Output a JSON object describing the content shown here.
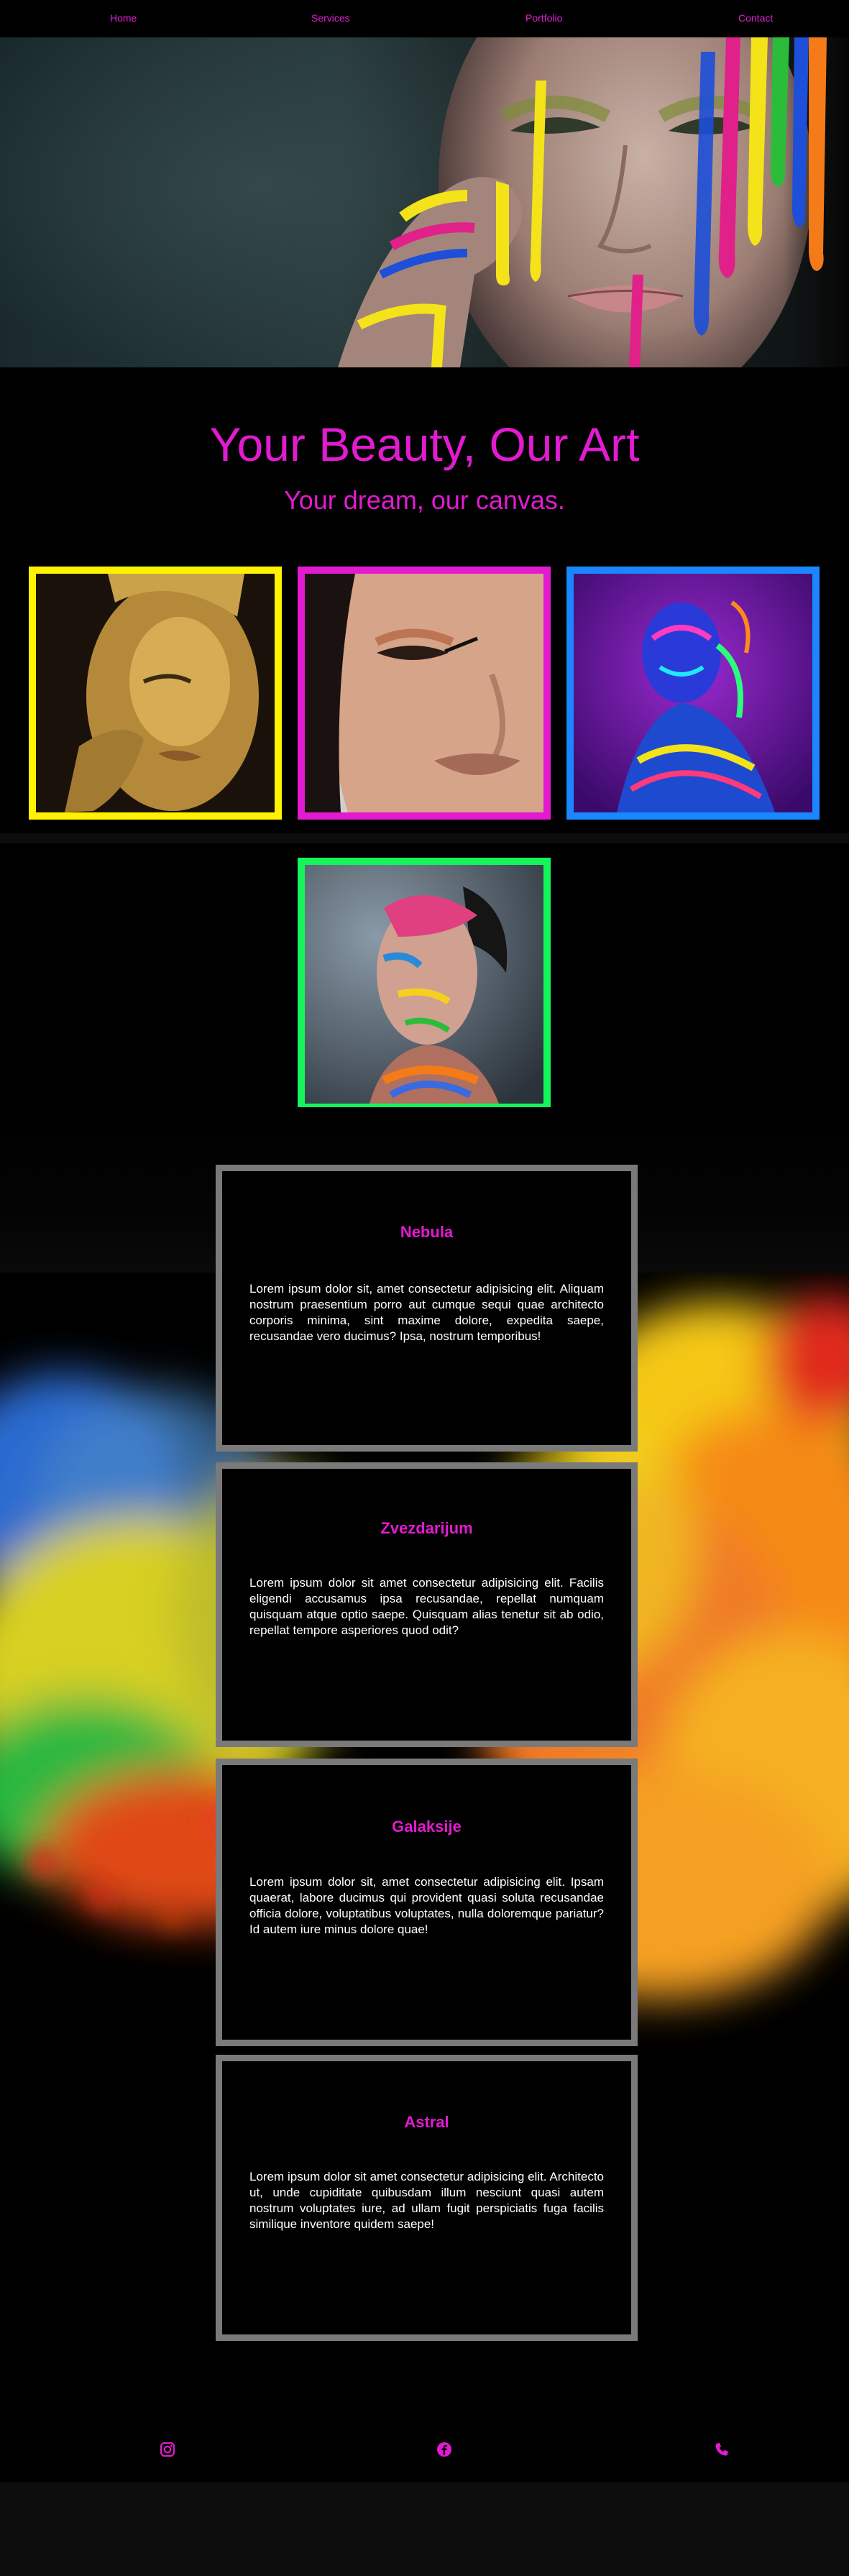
{
  "nav": {
    "items": [
      {
        "label": "Home"
      },
      {
        "label": "Services"
      },
      {
        "label": "Portfolio"
      },
      {
        "label": "Contact"
      }
    ]
  },
  "hero": {
    "image": "face-with-paint-drips",
    "colors": [
      "#f5e31a",
      "#e0218a",
      "#1d4fd8",
      "#2bbd3a",
      "#f57a18"
    ]
  },
  "headline": {
    "title": "Your Beauty, Our Art",
    "subtitle": "Your dream, our canvas."
  },
  "gallery": {
    "items": [
      {
        "image": "gold-makeup-portrait",
        "border_color": "#fff200"
      },
      {
        "image": "glam-eyeliner-portrait",
        "border_color": "#e21bd0"
      },
      {
        "image": "neon-uv-body-paint",
        "border_color": "#1a86ff"
      },
      {
        "image": "multicolor-face-paint",
        "border_color": "#14f55a"
      }
    ]
  },
  "cards": [
    {
      "title": "Nebula",
      "text": "Lorem ipsum dolor sit, amet consectetur adipisicing elit. Aliquam nostrum praesentium porro aut cumque sequi quae architecto corporis minima, sint maxime dolore, expedita saepe, recusandae vero ducimus? Ipsa, nostrum temporibus!"
    },
    {
      "title": "Zvezdarijum",
      "text": "Lorem ipsum dolor sit amet consectetur adipisicing elit. Facilis eligendi accusamus ipsa recusandae, repellat numquam quisquam atque optio saepe. Quisquam alias tenetur sit ab odio, repellat tempore asperiores quod odit?"
    },
    {
      "title": "Galaksije",
      "text": "Lorem ipsum dolor sit, amet consectetur adipisicing elit. Ipsam quaerat, labore ducimus qui provident quasi soluta recusandae officia dolore, voluptatibus voluptates, nulla doloremque pariatur? Id autem iure minus dolore quae!"
    },
    {
      "title": "Astral",
      "text": "Lorem ipsum dolor sit amet consectetur adipisicing elit. Architecto ut, unde cupiditate quibusdam illum nesciunt quasi autem nostrum voluptates iure, ad ullam fugit perspiciatis fuga facilis similique inventore quidem saepe!"
    }
  ],
  "footer": {
    "icons": [
      "instagram-icon",
      "facebook-icon",
      "phone-icon"
    ],
    "icon_color": "#e21bd0"
  },
  "colors": {
    "accent": "#e21bd0",
    "card_border": "#7a7a7a",
    "background": "#000000"
  }
}
